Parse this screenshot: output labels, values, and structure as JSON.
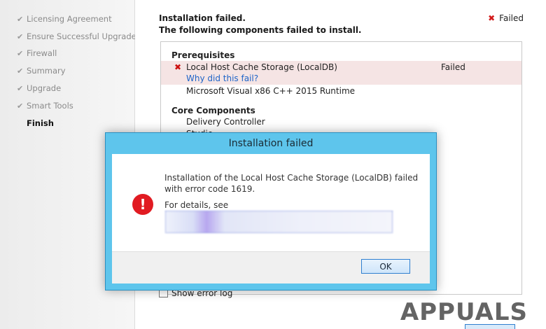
{
  "sidebar": {
    "steps": [
      {
        "label": "Licensing Agreement",
        "done": true
      },
      {
        "label": "Ensure Successful Upgrade",
        "done": true
      },
      {
        "label": "Firewall",
        "done": true
      },
      {
        "label": "Summary",
        "done": true
      },
      {
        "label": "Upgrade",
        "done": true
      },
      {
        "label": "Smart Tools",
        "done": true
      },
      {
        "label": "Finish",
        "done": false,
        "current": true
      }
    ]
  },
  "header": {
    "line1": "Installation failed.",
    "line2": "The following components failed to install.",
    "status": "Failed"
  },
  "components": {
    "prerequisites_title": "Prerequisites",
    "failed_item": "Local Host Cache Storage (LocalDB)",
    "failed_status": "Failed",
    "why_link": "Why did this fail?",
    "prereq_item2": "Microsoft Visual x86 C++ 2015 Runtime",
    "core_title": "Core Components",
    "core_item1": "Delivery Controller",
    "core_item2": "Studio"
  },
  "show_error_log": "Show error log",
  "dialog": {
    "title": "Installation failed",
    "message": "Installation of the Local Host Cache Storage (LocalDB) failed with error code 1619.",
    "details_label": "For details, see",
    "ok_label": "OK"
  },
  "icons": {
    "check": "check-icon",
    "fail": "x-mark-icon",
    "error": "error-exclamation-icon"
  },
  "colors": {
    "dialog_title_bar": "#5ec5ec",
    "fail_red": "#d21a1a",
    "link_blue": "#1e64c8",
    "failed_row_bg": "#f5e4e4"
  },
  "watermark": "APPUALS"
}
